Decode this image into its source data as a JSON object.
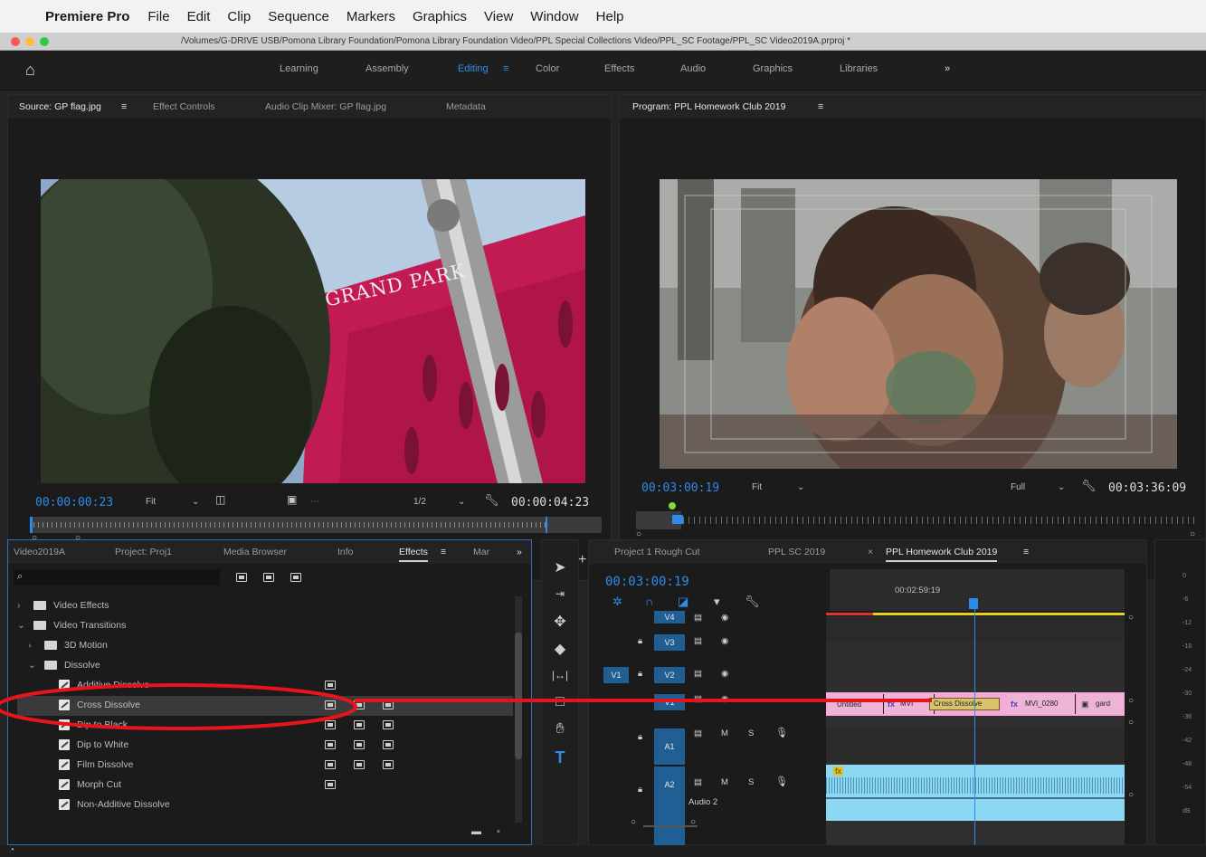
{
  "menubar": {
    "app": "Premiere Pro",
    "items": [
      "File",
      "Edit",
      "Clip",
      "Sequence",
      "Markers",
      "Graphics",
      "View",
      "Window",
      "Help"
    ]
  },
  "window": {
    "path": "/Volumes/G-DRIVE USB/Pomona Library Foundation/Pomona Library Foundation Video/PPL Special Collections Video/PPL_SC Footage/PPL_SC Video2019A.prproj *"
  },
  "workspaces": {
    "items": [
      "Learning",
      "Assembly",
      "Editing",
      "Color",
      "Effects",
      "Audio",
      "Graphics",
      "Libraries"
    ],
    "active": "Editing",
    "more": "»"
  },
  "source": {
    "tabs": [
      "Source: GP flag.jpg",
      "Effect Controls",
      "Audio Clip Mixer: GP flag.jpg",
      "Metadata"
    ],
    "menu": "≡",
    "image_text": "GRAND PARK",
    "timecode": "00:00:00:23",
    "fit": "Fit",
    "resolution": "1/2",
    "duration": "00:00:04:23"
  },
  "program": {
    "title": "Program: PPL Homework Club 2019",
    "menu": "≡",
    "timecode": "00:03:00:19",
    "fit": "Fit",
    "resolution": "Full",
    "duration": "00:03:36:09"
  },
  "project": {
    "tabs": [
      "Video2019A",
      "Project: Proj1",
      "Media Browser",
      "Info",
      "Effects",
      "Mar"
    ],
    "active": "Effects",
    "menu": "≡",
    "more": "»",
    "search_placeholder": "",
    "tree": [
      {
        "label": "Video Effects",
        "level": 0,
        "kind": "folder",
        "expanded": false
      },
      {
        "label": "Video Transitions",
        "level": 0,
        "kind": "folder",
        "expanded": true
      },
      {
        "label": "3D Motion",
        "level": 1,
        "kind": "folder",
        "expanded": false
      },
      {
        "label": "Dissolve",
        "level": 1,
        "kind": "folder",
        "expanded": true
      },
      {
        "label": "Additive Dissolve",
        "level": 2,
        "kind": "effect"
      },
      {
        "label": "Cross Dissolve",
        "level": 2,
        "kind": "effect",
        "selected": true
      },
      {
        "label": "Dip to Black",
        "level": 2,
        "kind": "effect"
      },
      {
        "label": "Dip to White",
        "level": 2,
        "kind": "effect"
      },
      {
        "label": "Film Dissolve",
        "level": 2,
        "kind": "effect"
      },
      {
        "label": "Morph Cut",
        "level": 2,
        "kind": "effect"
      },
      {
        "label": "Non-Additive Dissolve",
        "level": 2,
        "kind": "effect"
      }
    ]
  },
  "timeline": {
    "tabs": [
      "Project 1 Rough Cut",
      "PPL SC 2019",
      "PPL Homework Club 2019"
    ],
    "active": "PPL Homework Club 2019",
    "close": "×",
    "menu": "≡",
    "timecode": "00:03:00:19",
    "ruler_time": "00:02:59:19",
    "tracks": {
      "v4": "V4",
      "v3": "V3",
      "v2": "V2",
      "v1": "V1",
      "a1": "A1",
      "a2": "A2",
      "a2_name": "Audio 2",
      "src_v": "V1",
      "mute": "M",
      "solo": "S"
    },
    "clips": {
      "c1": "Untitled",
      "c2": "MVI",
      "transition": "Cross Dissolve",
      "c3": "MVI_0280",
      "c4": "gard"
    }
  },
  "meter": {
    "ticks": [
      "0",
      "-6",
      "-12",
      "-18",
      "-24",
      "-30",
      "-36",
      "-42",
      "-48",
      "-54",
      "dB"
    ]
  },
  "colors": {
    "accent": "#2d8ceb",
    "annotation": "#e8141c",
    "clip_pink": "#f5a9d6",
    "audio_clip": "#8cd8f2",
    "workarea": "#e6d21c"
  }
}
